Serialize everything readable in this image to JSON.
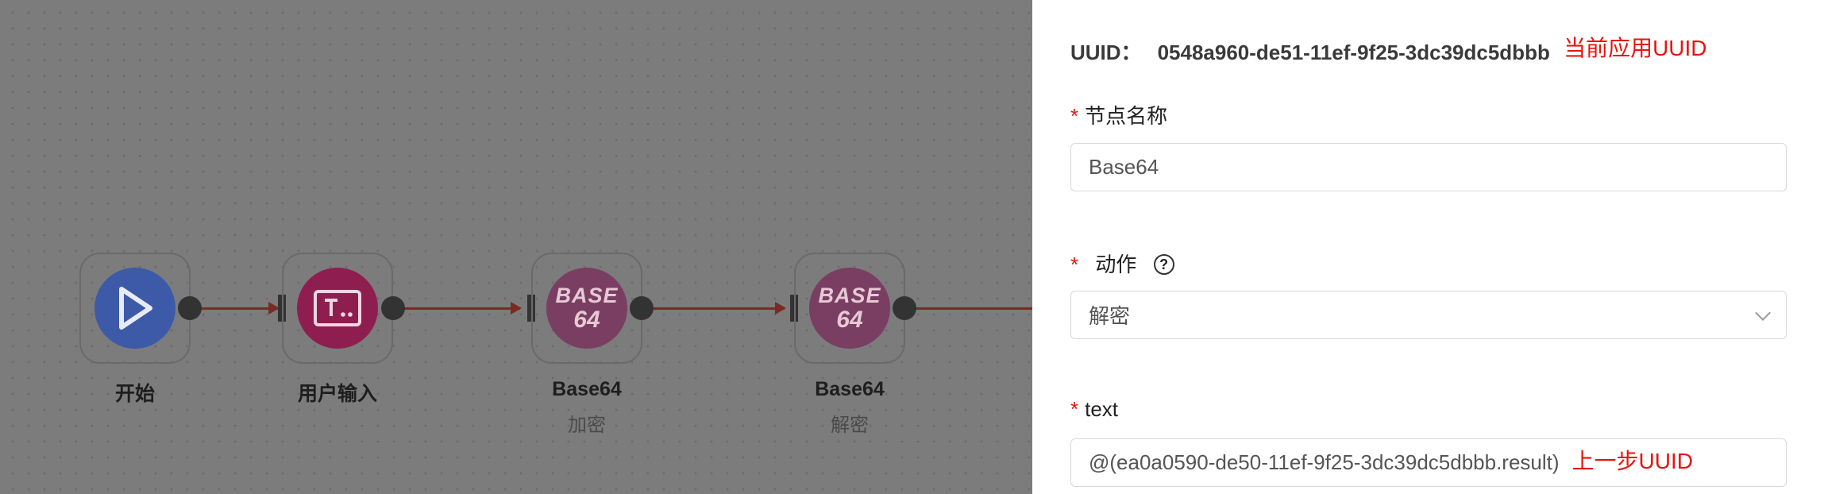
{
  "flow": {
    "nodes": [
      {
        "title": "开始",
        "subtitle": "",
        "icon": "play-icon",
        "color": "#3d5aa8"
      },
      {
        "title": "用户输入",
        "subtitle": "",
        "icon": "terminal-input-icon",
        "color": "#8e1e50"
      },
      {
        "title": "Base64",
        "subtitle": "加密",
        "icon": "base64-icon",
        "icon_text": [
          "BASE",
          "64"
        ],
        "color": "#7a3e62"
      },
      {
        "title": "Base64",
        "subtitle": "解密",
        "icon": "base64-icon",
        "icon_text": [
          "BASE",
          "64"
        ],
        "color": "#7a3e62"
      }
    ],
    "edge_color": "#7a2a22"
  },
  "panel": {
    "uuid_label": "UUID：",
    "uuid_value": "0548a960-de51-11ef-9f25-3dc39dc5dbbb",
    "uuid_note": "当前应用UUID",
    "name_label": "节点名称",
    "name_value": "Base64",
    "action_label": "动作",
    "action_value": "解密",
    "text_label": "text",
    "text_value": "@(ea0a0590-de50-11ef-9f25-3dc39dc5dbbb.result)",
    "text_note": "上一步UUID",
    "required_mark": "*",
    "help_glyph": "?",
    "accent_color": "#e8140f"
  }
}
